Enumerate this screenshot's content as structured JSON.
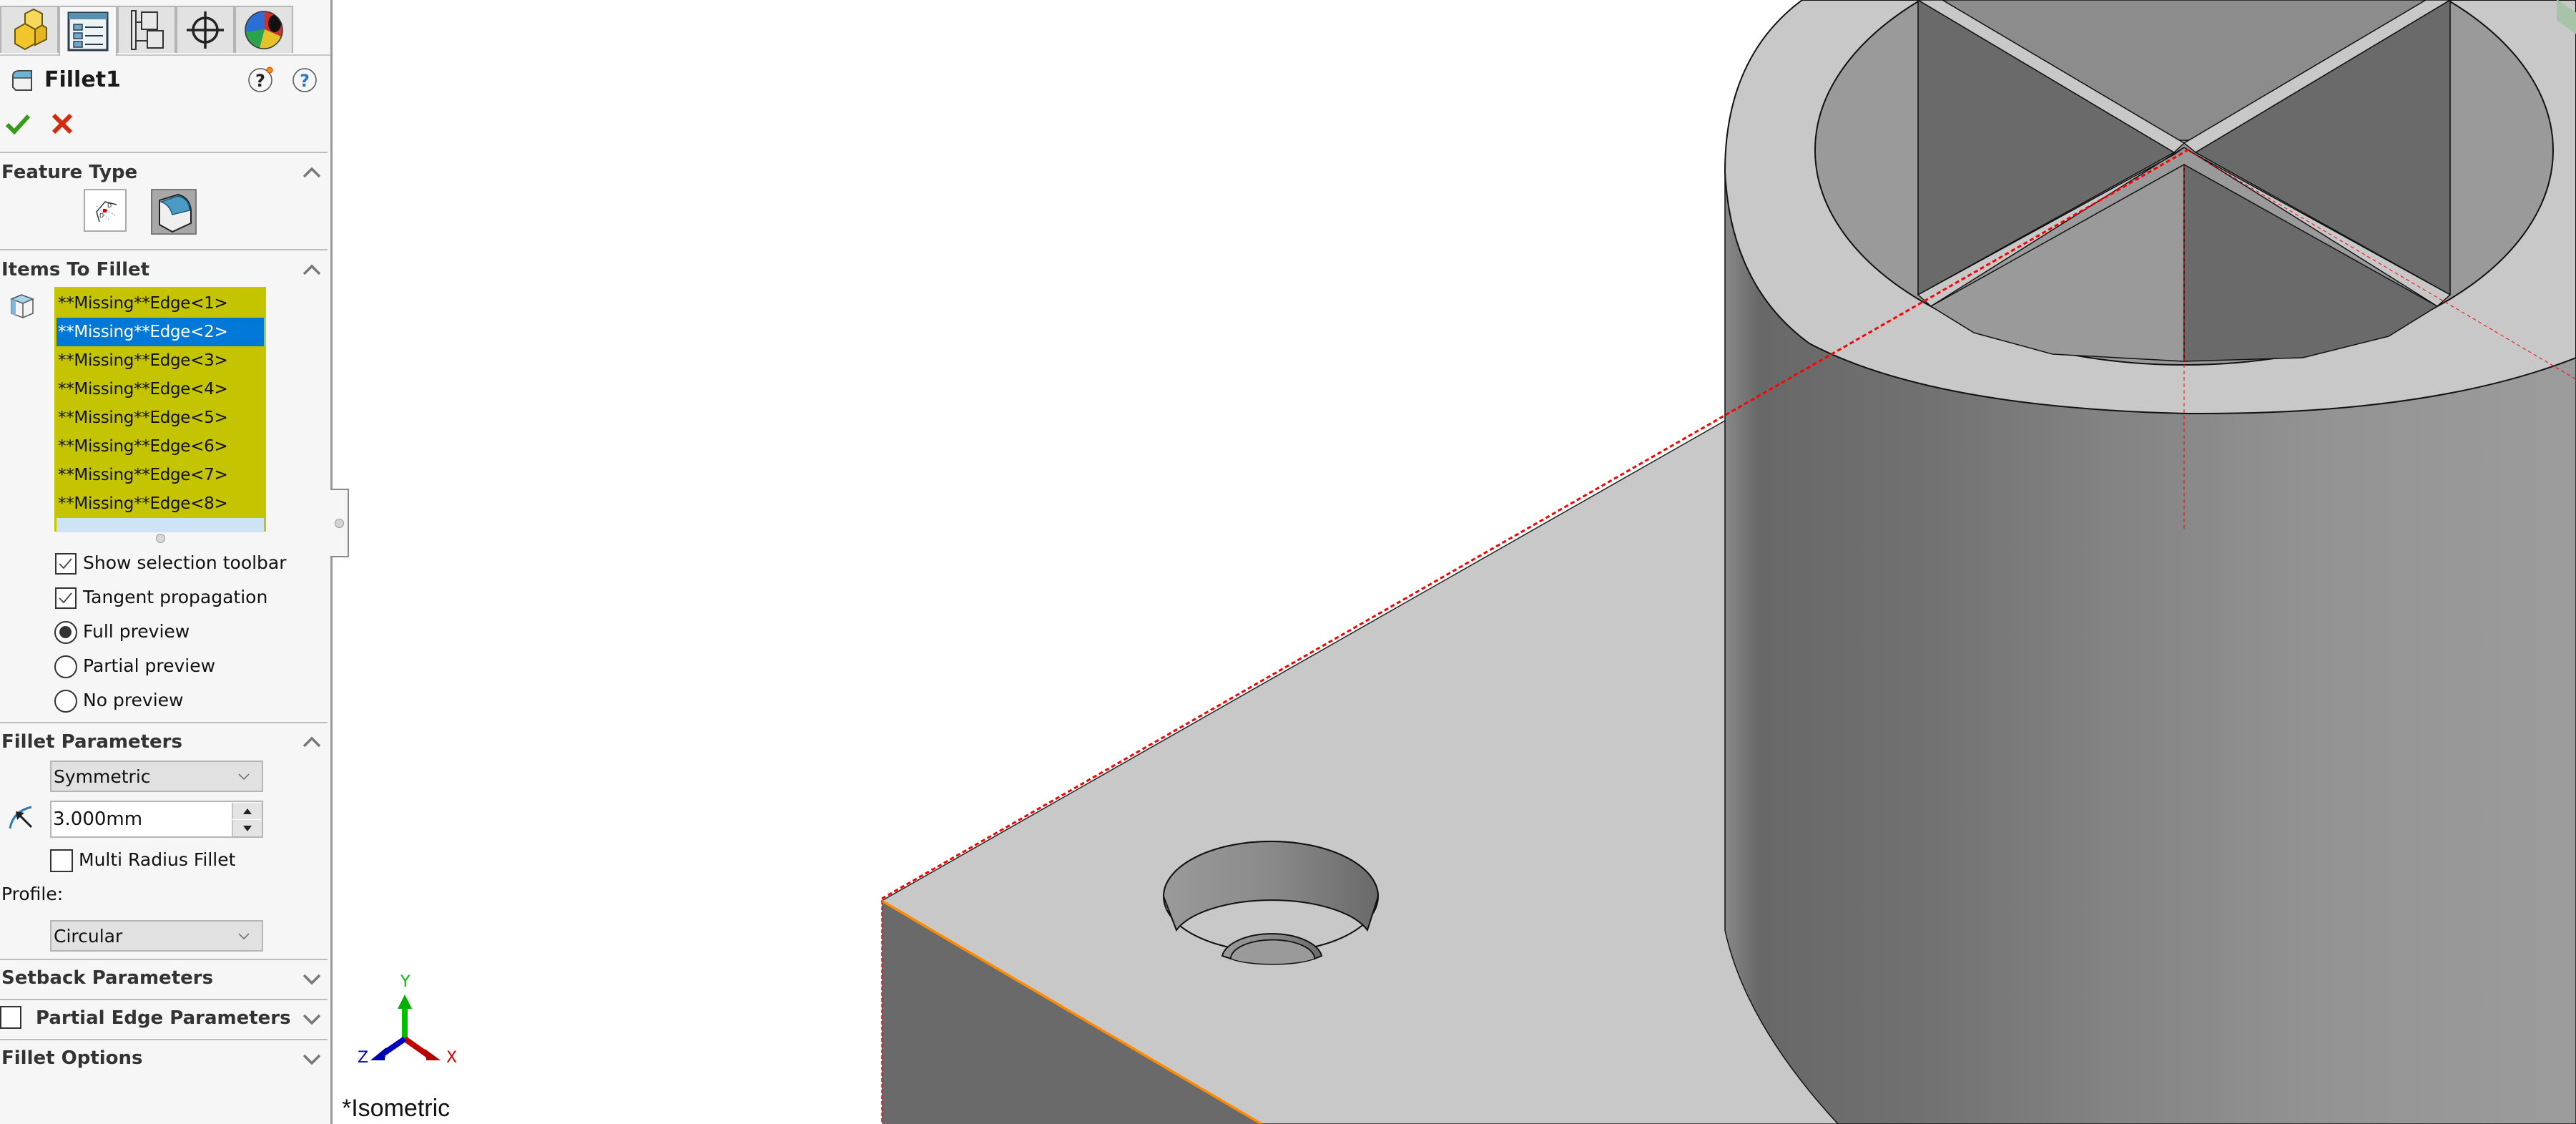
{
  "panel": {
    "tabs": [
      {
        "name": "FeatureManager design tree",
        "icon": "part-icon"
      },
      {
        "name": "PropertyManager",
        "icon": "property-manager-icon",
        "active": true
      },
      {
        "name": "ConfigurationManager",
        "icon": "configuration-manager-icon"
      },
      {
        "name": "DimXpertManager",
        "icon": "dimxpert-crosshair-icon"
      },
      {
        "name": "DisplayManager",
        "icon": "display-manager-sphere-icon"
      }
    ],
    "title": "Fillet1",
    "ok_icon": "checkmark-icon",
    "cancel_icon": "x-icon",
    "sections": {
      "feature_type": {
        "label": "Feature Type",
        "expanded": true,
        "options": [
          "Constant size fillet (dimensioned)",
          "Fillet"
        ],
        "selected": 1
      },
      "items_to_fillet": {
        "label": "Items To Fillet",
        "expanded": true,
        "items": [
          "**Missing**Edge<1>",
          "**Missing**Edge<2>",
          "**Missing**Edge<3>",
          "**Missing**Edge<4>",
          "**Missing**Edge<5>",
          "**Missing**Edge<6>",
          "**Missing**Edge<7>",
          "**Missing**Edge<8>"
        ],
        "selected_index": 1,
        "show_selection_toolbar": {
          "label": "Show selection toolbar",
          "checked": true
        },
        "tangent_propagation": {
          "label": "Tangent propagation",
          "checked": true
        },
        "preview_options": [
          {
            "label": "Full preview",
            "selected": true
          },
          {
            "label": "Partial preview",
            "selected": false
          },
          {
            "label": "No preview",
            "selected": false
          }
        ]
      },
      "fillet_parameters": {
        "label": "Fillet Parameters",
        "expanded": true,
        "method": "Symmetric",
        "radius": "3.000mm",
        "multi_radius": {
          "label": "Multi Radius Fillet",
          "checked": false
        },
        "profile_label": "Profile:",
        "profile": "Circular"
      },
      "setback_parameters": {
        "label": "Setback Parameters",
        "expanded": false
      },
      "partial_edge_parameters": {
        "label": "Partial Edge Parameters",
        "expanded": false,
        "checked": false
      },
      "fillet_options": {
        "label": "Fillet Options",
        "expanded": false
      }
    }
  },
  "viewport": {
    "view_name": "*Isometric",
    "triad": {
      "x": "X",
      "y": "Y",
      "z": "Z"
    },
    "colors": {
      "list_bg": "#c4c400",
      "selection_blue": "#0078d7",
      "missing_edge_red": "#ff0000",
      "highlight_edge_orange": "#ff8a00",
      "face_light": "#c8c8c8",
      "face_dark": "#6a6a6a",
      "triad_x": "#c00000",
      "triad_y": "#00c000",
      "triad_z": "#0000c0"
    }
  }
}
